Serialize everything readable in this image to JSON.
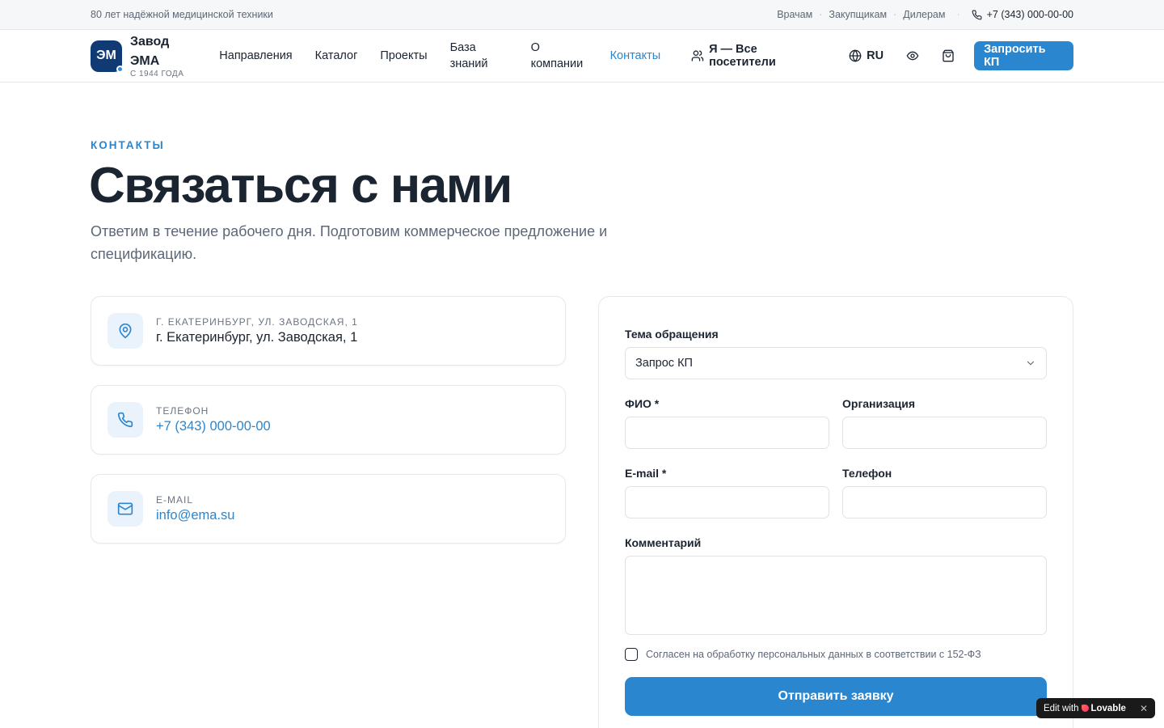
{
  "topbar": {
    "tagline": "80 лет надёжной медицинской техники",
    "links": [
      "Врачам",
      "Закупщикам",
      "Дилерам"
    ],
    "phone": "+7 (343) 000-00-00"
  },
  "header": {
    "logo_mark": "ЭМ",
    "logo_name": "Завод ЭМА",
    "logo_sub": "С 1944 ГОДА",
    "nav": [
      "Направления",
      "Каталог",
      "Проекты",
      "База знаний",
      "О компании",
      "Контакты"
    ],
    "audience": "Я — Все посетители",
    "language": "RU",
    "cta": "Запросить КП"
  },
  "hero": {
    "eyebrow": "КОНТАКТЫ",
    "title": "Связаться с нами",
    "subtitle": "Ответим в течение рабочего дня. Подготовим коммерческое предложение и спецификацию."
  },
  "contacts": [
    {
      "label": "Г. ЕКАТЕРИНБУРГ, УЛ. ЗАВОДСКАЯ, 1",
      "value": "г. Екатеринбург, ул. Заводская, 1"
    },
    {
      "label": "ТЕЛЕФОН",
      "value": "+7 (343) 000-00-00"
    },
    {
      "label": "E-MAIL",
      "value": "info@ema.su"
    }
  ],
  "form": {
    "topic_label": "Тема обращения",
    "topic_value": "Запрос КП",
    "name_label": "ФИО *",
    "org_label": "Организация",
    "email_label": "E-mail *",
    "phone_label": "Телефон",
    "comment_label": "Комментарий",
    "consent": "Согласен на обработку персональных данных в соответствии с 152-ФЗ",
    "submit": "Отправить заявку"
  },
  "badge": {
    "prefix": "Edit with",
    "brand": "Lovable",
    "close": "✕"
  },
  "colors": {
    "accent": "#2a86cf",
    "logo": "#0f3a73",
    "text": "#1b2431",
    "muted": "#5d6776"
  }
}
